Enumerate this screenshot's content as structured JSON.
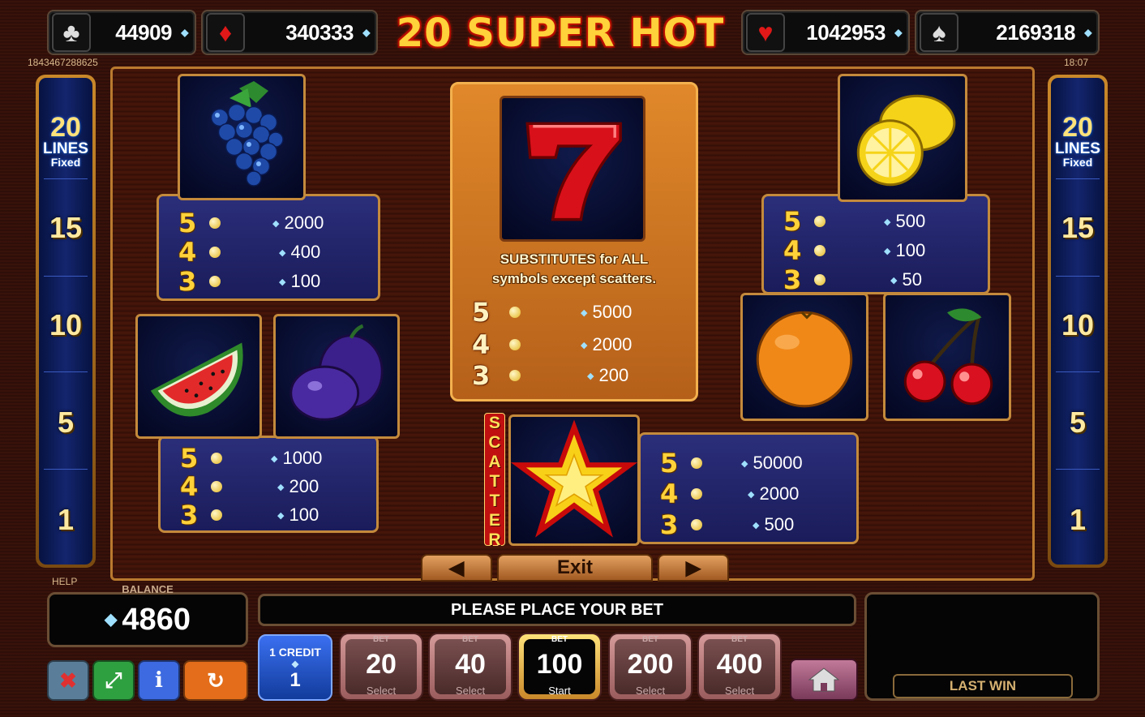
{
  "title": "20 SUPER HOT",
  "jackpots": [
    {
      "suit": "clubs",
      "icon": "club-icon",
      "glyph": "♣",
      "value": "44909"
    },
    {
      "suit": "diamonds",
      "icon": "diamond-icon",
      "glyph": "♦",
      "value": "340333"
    },
    {
      "suit": "hearts",
      "icon": "heart-icon",
      "glyph": "♥",
      "value": "1042953"
    },
    {
      "suit": "spades",
      "icon": "spade-icon",
      "glyph": "♠",
      "value": "2169318"
    }
  ],
  "session_id": "1843467288625",
  "clock": "18:07",
  "lines": {
    "total": "20",
    "word": "LINES",
    "mode": "Fixed",
    "markers": [
      "15",
      "10",
      "5",
      "1"
    ]
  },
  "paytable": {
    "grapes": {
      "icon": "grapes-icon",
      "rows": [
        {
          "count": "5",
          "value": "2000"
        },
        {
          "count": "4",
          "value": "400"
        },
        {
          "count": "3",
          "value": "100"
        }
      ]
    },
    "lemon": {
      "icon": "lemon-icon",
      "rows": [
        {
          "count": "5",
          "value": "500"
        },
        {
          "count": "4",
          "value": "100"
        },
        {
          "count": "3",
          "value": "50"
        }
      ]
    },
    "melon_plum": {
      "icons": [
        "watermelon-icon",
        "plum-icon"
      ],
      "rows": [
        {
          "count": "5",
          "value": "1000"
        },
        {
          "count": "4",
          "value": "200"
        },
        {
          "count": "3",
          "value": "100"
        }
      ]
    },
    "orange_cherry": {
      "icons": [
        "orange-icon",
        "cherry-icon"
      ]
    },
    "seven": {
      "icon": "seven-icon",
      "text_line1": "SUBSTITUTES for ALL",
      "text_line2": "symbols except scatters.",
      "rows": [
        {
          "count": "5",
          "value": "5000"
        },
        {
          "count": "4",
          "value": "2000"
        },
        {
          "count": "3",
          "value": "200"
        }
      ]
    },
    "star": {
      "icon": "star-icon",
      "label_letters": [
        "S",
        "C",
        "A",
        "T",
        "T",
        "E",
        "R"
      ],
      "rows": [
        {
          "count": "5",
          "value": "50000"
        },
        {
          "count": "4",
          "value": "2000"
        },
        {
          "count": "3",
          "value": "500"
        }
      ]
    }
  },
  "nav": {
    "prev": "◀",
    "exit": "Exit",
    "next": "▶"
  },
  "help_label": "HELP",
  "balance": {
    "label": "BALANCE",
    "value": "4860"
  },
  "message": "PLEASE PLACE YOUR BET",
  "last_win": {
    "label": "LAST WIN"
  },
  "credit": {
    "label": "1 CREDIT",
    "value": "1"
  },
  "bets": [
    {
      "top": "BET",
      "value": "20",
      "sub": "Select",
      "active": false
    },
    {
      "top": "BET",
      "value": "40",
      "sub": "Select",
      "active": false
    },
    {
      "top": "BET",
      "value": "100",
      "sub": "Start",
      "active": true
    },
    {
      "top": "BET",
      "value": "200",
      "sub": "Select",
      "active": false
    },
    {
      "top": "BET",
      "value": "400",
      "sub": "Select",
      "active": false
    }
  ],
  "controls": {
    "sound": {
      "icon": "sound-off-icon",
      "glyph": "✖",
      "color": "#5a7e9a"
    },
    "fullscreen": {
      "icon": "fullscreen-icon",
      "glyph": "⤢",
      "color": "#2fa040"
    },
    "info": {
      "icon": "info-icon",
      "glyph": "i",
      "color": "#3d6ae0"
    },
    "autoplay": {
      "icon": "autoplay-icon",
      "glyph": "↻",
      "color": "#e36d1a"
    },
    "home": {
      "icon": "home-icon"
    }
  },
  "colors": {
    "gold": "#ffd23a",
    "panel_border": "#c48a3c",
    "wild_bg": "#d07a24",
    "pay_bg": "#24276e"
  }
}
